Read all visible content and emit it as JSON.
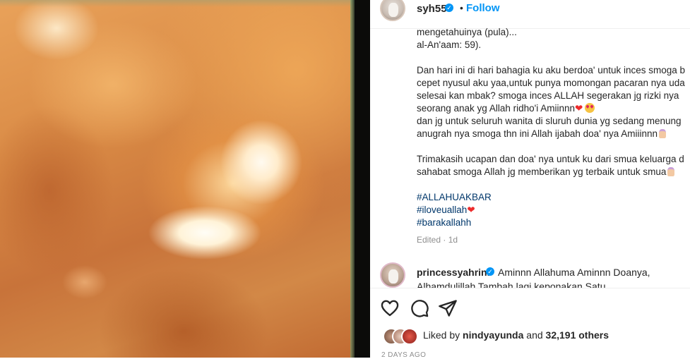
{
  "post": {
    "username": "syh55",
    "separator": "•",
    "follow_label": "Follow",
    "caption_lines": [
      "mengetahuinya (pula)...",
      "al-An'aam: 59).",
      "",
      "Dan hari ini di hari bahagia ku aku berdoa' untuk inces smoga b",
      "cepet nyusul aku yaa,untuk punya momongan pacaran nya uda",
      "selesai kan mbak? smoga inces ALLAH segerakan jg rizki nya",
      "seorang anak yg Allah ridho'i Amiinnn",
      "dan jg untuk seluruh wanita di sluruh dunia yg sedang menung",
      "anugrah nya smoga thn ini Allah ijabah doa' nya Amiiinnn",
      "",
      "Trimakasih ucapan dan doa' nya untuk ku dari smua keluarga d",
      "sahabat smoga Allah jg memberikan yg terbaik untuk smua"
    ],
    "hashtags": [
      "#ALLAHUAKBAR",
      "#iloveuallah",
      "#barakallahh"
    ],
    "heart_glyph": "❤",
    "edited_label": "Edited · 1d"
  },
  "comment": {
    "username": "princessyahrini",
    "text": "Aminnn Allahuma Aminnn Doanya,",
    "text_line2": "Alhamdulillah Tambah lagi keponakan Satu"
  },
  "actions": {
    "like_icon": "heart-outline-icon",
    "comment_icon": "comment-bubble-icon",
    "share_icon": "paper-plane-icon"
  },
  "likes": {
    "prefix": "Liked by",
    "first_user": "nindyayunda",
    "joiner": "and",
    "others": "32,191 others"
  },
  "time_ago": "2 DAYS AGO",
  "colors": {
    "accent_blue": "#0095f6",
    "hashtag_blue": "#00376b",
    "heart_red": "#ed2b2b",
    "muted_gray": "#8e8e8e"
  }
}
